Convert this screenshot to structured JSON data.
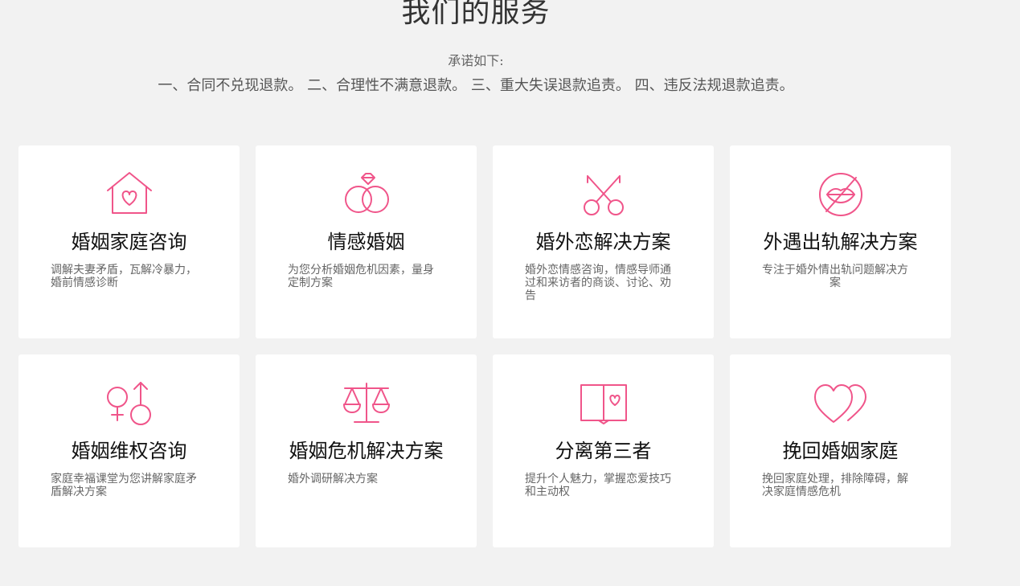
{
  "header": {
    "title": "我们的服务",
    "promise_heading": "承诺如下:",
    "promise_items": "一、合同不兑现退款。 二、合理性不满意退款。 三、重大失误退款追责。 四、违反法规退款追责。"
  },
  "theme": {
    "accent": "#f0558a",
    "background": "#f2f2f2",
    "card": "#ffffff"
  },
  "services": [
    {
      "icon": "house-heart-icon",
      "title": "婚姻家庭咨询",
      "desc": "调解夫妻矛盾，瓦解冷暴力，婚前情感诊断"
    },
    {
      "icon": "rings-icon",
      "title": "情感婚姻",
      "desc": "为您分析婚姻危机因素，量身定制方案"
    },
    {
      "icon": "scissors-icon",
      "title": "婚外恋解决方案",
      "desc": "婚外恋情感咨询，情感导师通过和来访者的商谈、讨论、劝告"
    },
    {
      "icon": "no-kissing-icon",
      "title": "外遇出轨解决方案",
      "desc": "专注于婚外情出轨问题解决方案"
    },
    {
      "icon": "gender-symbols-icon",
      "title": "婚姻维权咨询",
      "desc": "家庭幸福课堂为您讲解家庭矛盾解决方案"
    },
    {
      "icon": "balance-scale-icon",
      "title": "婚姻危机解决方案",
      "desc": "婚外调研解决方案"
    },
    {
      "icon": "book-heart-icon",
      "title": "分离第三者",
      "desc": "提升个人魅力，掌握恋爱技巧和主动权"
    },
    {
      "icon": "two-hearts-icon",
      "title": "挽回婚姻家庭",
      "desc": "挽回家庭处理，排除障碍，解决家庭情感危机"
    }
  ]
}
